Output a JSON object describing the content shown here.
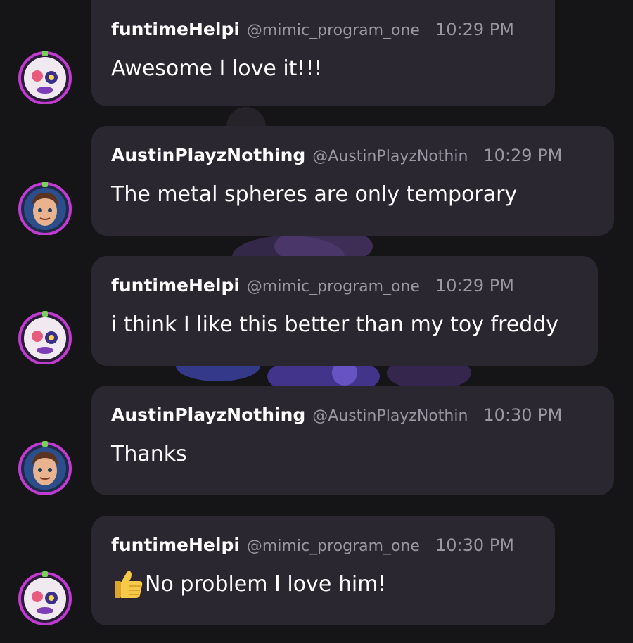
{
  "messages": [
    {
      "author": "funtimeHelpi",
      "handle": "@mimic_program_one",
      "time": "10:29 PM",
      "text": "Awesome I love it!!!",
      "avatar": "funtime-helpy-avatar",
      "emoji": null
    },
    {
      "author": "AustinPlayzNothing",
      "handle": "@AustinPlayzNothin",
      "time": "10:29 PM",
      "text": "The metal spheres are only temporary",
      "avatar": "austin-avatar",
      "emoji": null
    },
    {
      "author": "funtimeHelpi",
      "handle": "@mimic_program_one",
      "time": "10:29 PM",
      "text": "i think I like this better than my toy freddy",
      "avatar": "funtime-helpy-avatar",
      "emoji": null
    },
    {
      "author": "AustinPlayzNothing",
      "handle": "@AustinPlayzNothin",
      "time": "10:30 PM",
      "text": "Thanks",
      "avatar": "austin-avatar",
      "emoji": null
    },
    {
      "author": "funtimeHelpi",
      "handle": "@mimic_program_one",
      "time": "10:30 PM",
      "text": "No problem I love him!",
      "avatar": "funtime-helpy-avatar",
      "emoji": "thumbs-up-icon"
    }
  ],
  "colors": {
    "background": "#151417",
    "bubble": "#2a2730",
    "name": "#ffffff",
    "meta": "#9a97a1",
    "avatar_ring": "#c13bd0"
  }
}
